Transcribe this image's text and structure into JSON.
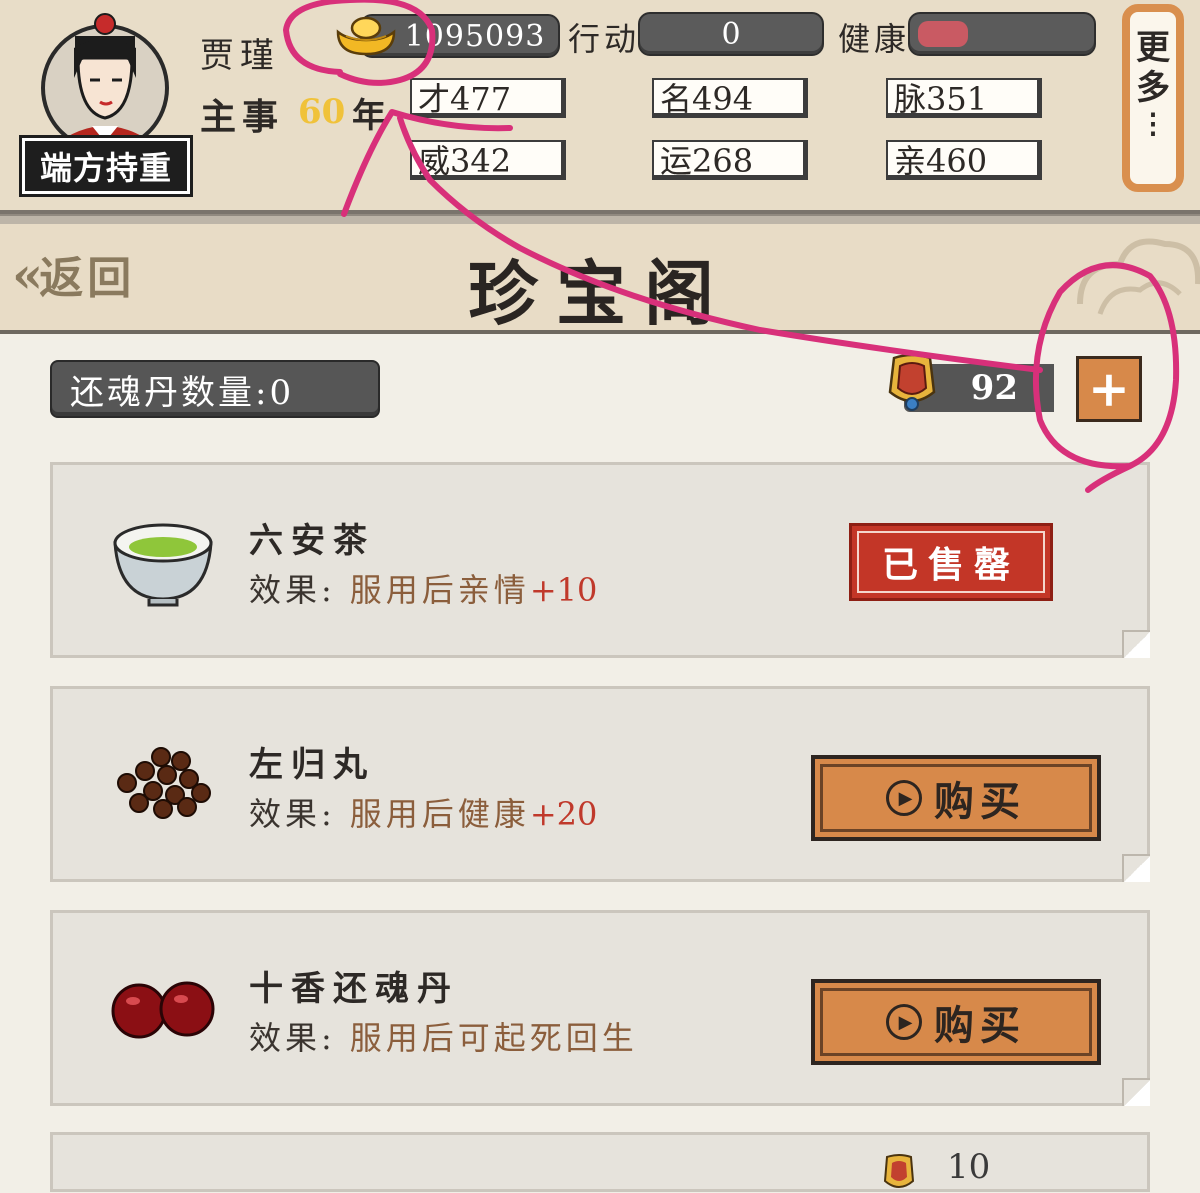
{
  "header": {
    "title_badge": "端方持重",
    "character_name": "贾瑾",
    "role_label": "主事",
    "years_value": "60",
    "years_unit": "年",
    "gold_value": "1095093",
    "action_label": "行动",
    "action_value": "0",
    "health_label": "健康",
    "health_level_fraction": 0.3,
    "stats": [
      {
        "value": "才477"
      },
      {
        "value": "名494"
      },
      {
        "value": "脉351"
      },
      {
        "value": "威342"
      },
      {
        "value": "运268"
      },
      {
        "value": "亲460"
      }
    ],
    "more_label": "更多",
    "more_dots": "⋮"
  },
  "titlebar": {
    "back_label": "返回",
    "back_chevron": "«",
    "page_title": "珍宝阁"
  },
  "shop": {
    "revive_count_label": "还魂丹数量:0",
    "jade_value": "92",
    "plus_label": "+"
  },
  "items": [
    {
      "name": "六安茶",
      "effect_label": "效果:",
      "effect_desc": "服用后亲情",
      "effect_bonus": "+10",
      "status": "已售罄",
      "icon": "tea-bowl-icon"
    },
    {
      "name": "左归丸",
      "effect_label": "效果:",
      "effect_desc": "服用后健康",
      "effect_bonus": "+20",
      "button": "购买",
      "icon": "pills-icon"
    },
    {
      "name": "十香还魂丹",
      "effect_label": "效果:",
      "effect_desc": "服用后可起死回生",
      "effect_bonus": "",
      "button": "购买",
      "icon": "red-pills-icon"
    }
  ],
  "partial_item": {
    "price": "10"
  },
  "colors": {
    "annotation": "#d8307a",
    "accent_orange": "#d7894a",
    "soldout_red": "#c33627",
    "gold": "#f0c23a"
  }
}
